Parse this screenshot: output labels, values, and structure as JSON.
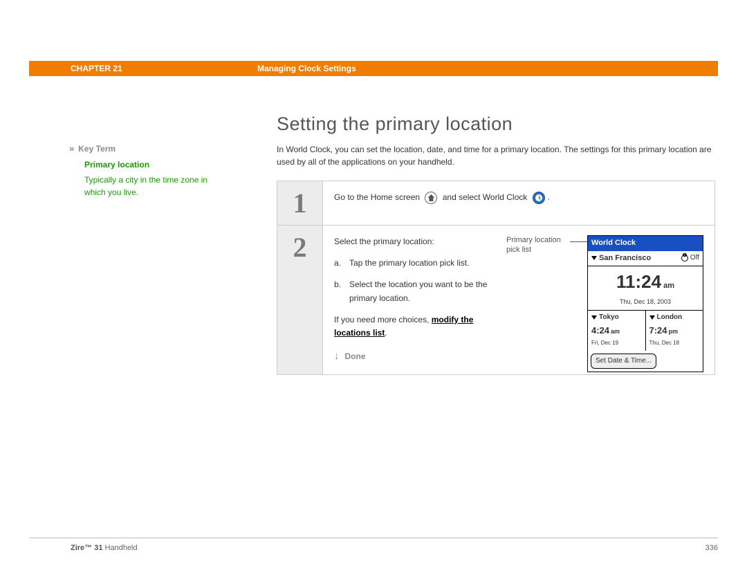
{
  "header": {
    "chapter": "CHAPTER 21",
    "section_title": "Managing Clock Settings"
  },
  "sidebar": {
    "keyterm_label": "Key Term",
    "keyterm_name": "Primary location",
    "keyterm_def": "Typically a city in the time zone in which you live."
  },
  "main": {
    "title": "Setting the primary location",
    "intro": "In World Clock, you can set the location, date, and time for a primary location. The settings for this primary location are used by all of the applications on your handheld.",
    "step1": {
      "num": "1",
      "pre": "Go to the Home screen",
      "mid": "and select World Clock",
      "end": "."
    },
    "step2": {
      "num": "2",
      "lead": "Select the primary location:",
      "a_marker": "a.",
      "a_text": "Tap the primary location pick list.",
      "b_marker": "b.",
      "b_text": "Select the location you want to be the primary location.",
      "more_pre": "If you need more choices, ",
      "more_link": "modify the locations list",
      "more_post": ".",
      "done": "Done",
      "callout": "Primary location pick list"
    }
  },
  "worldclock": {
    "title": "World Clock",
    "primary_city": "San Francisco",
    "alarm_label": "Off",
    "big_time": "11:24",
    "big_ampm": "am",
    "big_date": "Thu, Dec 18, 2003",
    "col1_city": "Tokyo",
    "col1_time": "4:24",
    "col1_ampm": "am",
    "col1_date": "Fri, Dec 19",
    "col2_city": "London",
    "col2_time": "7:24",
    "col2_ampm": "pm",
    "col2_date": "Thu, Dec 18",
    "button": "Set Date & Time..."
  },
  "footer": {
    "product_bold": "Zire™ 31",
    "product_rest": " Handheld",
    "page": "336"
  }
}
